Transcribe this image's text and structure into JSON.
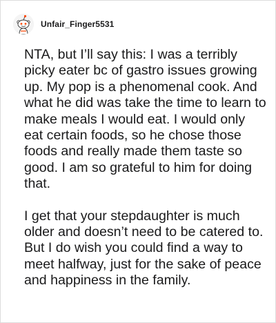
{
  "comment": {
    "username": "Unfair_Finger5531",
    "avatar_icon": "reddit-snoo-avatar-icon",
    "paragraphs": [
      "NTA, but I’ll say this: I was a terribly picky eater bc of gastro issues growing up. My pop is a phenomenal cook. And what he did was take the time to learn to make meals I would eat. I would only eat certain foods, so he chose those foods and really made them taste so good. I am so grateful to him for doing that.",
      "I get that your stepdaughter is much older and doesn’t need to be catered to. But I do wish you could find a way to meet halfway, just for the sake of peace and happiness in the family."
    ]
  },
  "colors": {
    "text": "#1a1a1b",
    "border": "#dcdcdc",
    "background": "#ffffff"
  }
}
